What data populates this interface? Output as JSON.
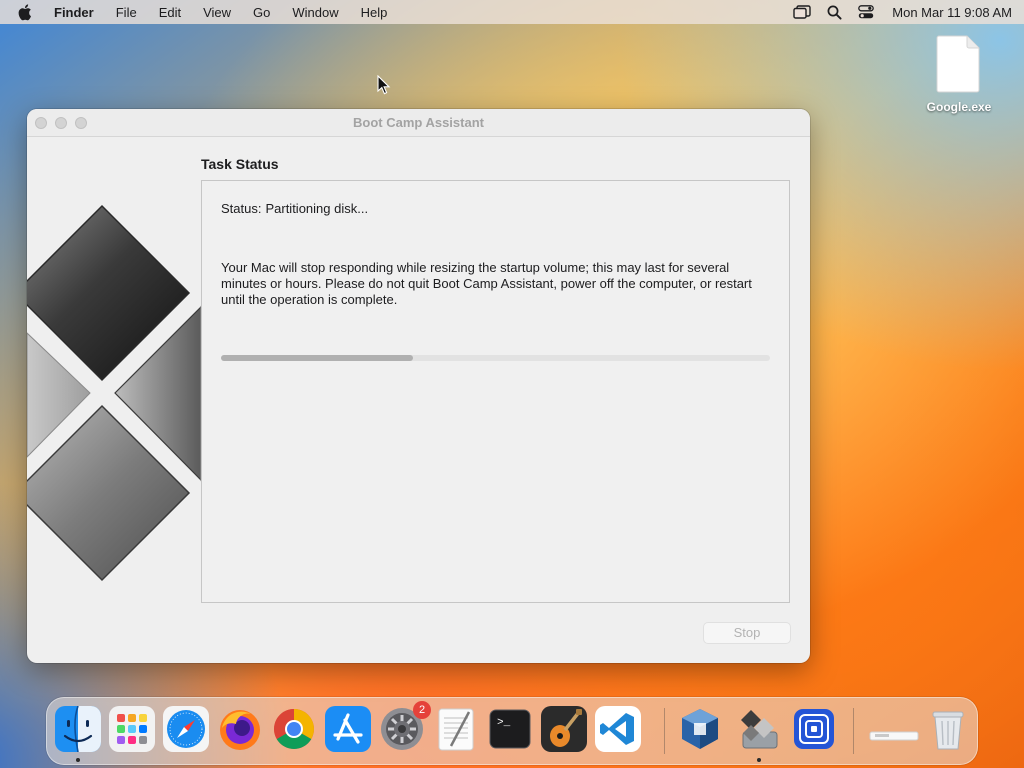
{
  "menubar": {
    "app_name": "Finder",
    "items": [
      "File",
      "Edit",
      "View",
      "Go",
      "Window",
      "Help"
    ],
    "status_icons": [
      "screen-mirroring-icon",
      "spotlight-search-icon",
      "control-center-icon"
    ],
    "clock": "Mon Mar 11  9:08 AM"
  },
  "desktop": {
    "file_name": "Google.exe",
    "file_icon": "document-icon"
  },
  "window": {
    "title": "Boot Camp Assistant",
    "section_title": "Task Status",
    "status_prefix": "Status:",
    "status_value": "Partitioning disk...",
    "message": "Your Mac will stop responding while resizing the startup volume; this may last for several minutes or hours. Please do not quit Boot Camp Assistant, power off the computer, or restart until the operation is complete.",
    "progress_fraction": 0.35,
    "stop_label": "Stop",
    "stop_enabled": false
  },
  "dock": {
    "items": [
      {
        "name": "finder",
        "running": true
      },
      {
        "name": "launchpad",
        "running": false
      },
      {
        "name": "safari",
        "running": false
      },
      {
        "name": "firefox",
        "running": false
      },
      {
        "name": "chrome",
        "running": false
      },
      {
        "name": "app-store",
        "running": false
      },
      {
        "name": "system-settings",
        "running": false,
        "badge": "2"
      },
      {
        "name": "textedit",
        "running": false
      },
      {
        "name": "terminal",
        "running": false
      },
      {
        "name": "garageband",
        "running": false
      },
      {
        "name": "vscode",
        "running": false
      },
      {
        "name": "virtualbox",
        "running": false
      },
      {
        "name": "boot-camp-assistant",
        "running": true
      },
      {
        "name": "app-blue",
        "running": false
      },
      {
        "name": "downloads-stack",
        "running": false
      },
      {
        "name": "trash",
        "running": false
      }
    ]
  },
  "colors": {
    "accent_blue": "#1d6fe0",
    "badge_red": "#e5423a",
    "window_bg": "#efefef"
  }
}
